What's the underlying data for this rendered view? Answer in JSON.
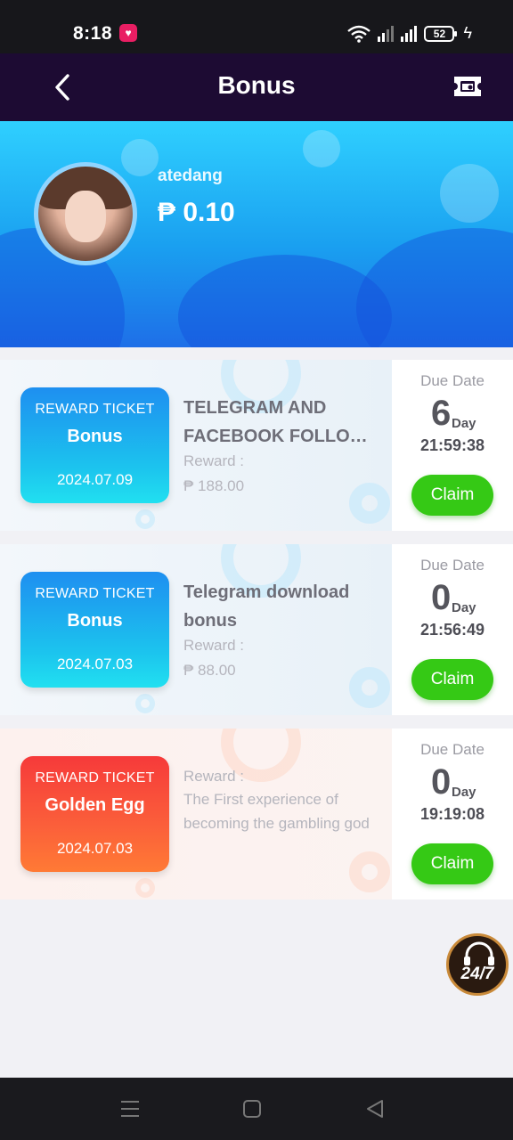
{
  "status_bar": {
    "time": "8:18",
    "battery": "52",
    "icons": [
      "notification-app-icon",
      "wifi-icon",
      "signal-icon",
      "signal-icon",
      "battery-icon",
      "charging-icon"
    ]
  },
  "header": {
    "title": "Bonus",
    "back_icon": "chevron-left-icon",
    "action_icon": "ticket-icon"
  },
  "profile": {
    "username": "atedang",
    "balance": "₱ 0.10"
  },
  "rewards": [
    {
      "ticket_label": "REWARD TICKET",
      "ticket_name": "Bonus",
      "ticket_date": "2024.07.09",
      "title_line1": "TELEGRAM AND",
      "title_line2": "FACEBOOK FOLLOW...",
      "reward_label": "Reward :",
      "reward_amount": "₱ 188.00",
      "due_label": "Due Date",
      "due_days": "6",
      "due_unit": "Day",
      "due_time": "21:59:38",
      "claim_label": "Claim"
    },
    {
      "ticket_label": "REWARD TICKET",
      "ticket_name": "Bonus",
      "ticket_date": "2024.07.03",
      "title_line1": "Telegram download",
      "title_line2": "bonus",
      "reward_label": "Reward :",
      "reward_amount": "₱ 88.00",
      "due_label": "Due Date",
      "due_days": "0",
      "due_unit": "Day",
      "due_time": "21:56:49",
      "claim_label": "Claim"
    },
    {
      "ticket_label": "REWARD TICKET",
      "ticket_name": "Golden Egg",
      "ticket_date": "2024.07.03",
      "reward_label": "Reward :",
      "reward_desc": "The First experience of becoming the gambling god",
      "due_label": "Due Date",
      "due_days": "0",
      "due_unit": "Day",
      "due_time": "19:19:08",
      "claim_label": "Claim"
    }
  ],
  "support": {
    "label": "24/7"
  },
  "colors": {
    "header_bg": "#1d0b33",
    "claim_green": "#35c915",
    "ticket_blue": "#1e8ff0",
    "ticket_red": "#f63a3a"
  }
}
